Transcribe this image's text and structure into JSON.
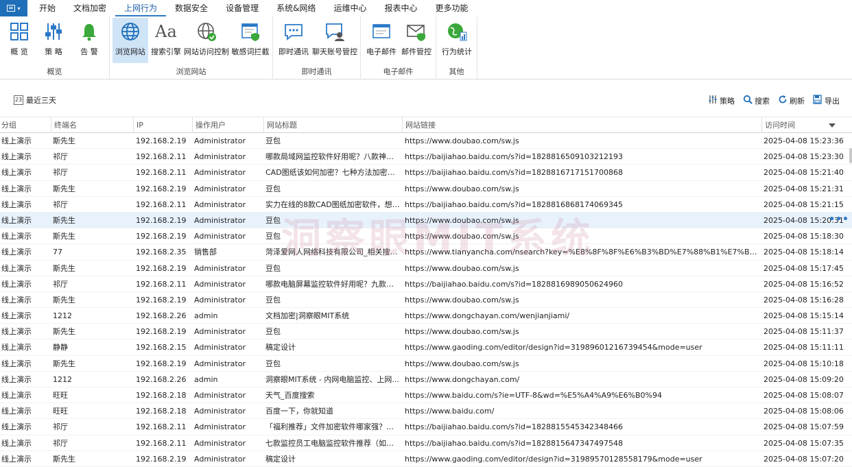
{
  "menubar": {
    "tabs": [
      "开始",
      "文档加密",
      "上网行为",
      "数据安全",
      "设备管理",
      "系统&网络",
      "运维中心",
      "报表中心",
      "更多功能"
    ],
    "active_tab": "上网行为"
  },
  "ribbon": {
    "groups": {
      "overview": {
        "label": "概览",
        "buttons": [
          "概 览",
          "策 略",
          "告 警"
        ]
      },
      "browse": {
        "label": "浏览网站",
        "buttons": [
          "浏览网站",
          "搜索引擎",
          "网站访问控制",
          "敏感词拦截"
        ]
      },
      "im": {
        "label": "即时通讯",
        "buttons": [
          "即时通讯",
          "聊天账号管控"
        ]
      },
      "email": {
        "label": "电子邮件",
        "buttons": [
          "电子邮件",
          "邮件管控"
        ]
      },
      "other": {
        "label": "其他",
        "buttons": [
          "行为统计"
        ]
      }
    }
  },
  "toolbar": {
    "date_range": "最近三天",
    "calendar_num": "23",
    "strategy": "策略",
    "search": "搜索",
    "refresh": "刷新",
    "export": "导出"
  },
  "table": {
    "columns": [
      "分组",
      "终端名",
      "IP",
      "操作用户",
      "网站标题",
      "网站链接",
      "访问时间"
    ],
    "rows": [
      [
        "线上演示",
        "斯先生",
        "192.168.2.19",
        "Administrator",
        "豆包",
        "https://www.doubao.com/sw.js",
        "2025-04-08 15:23:36"
      ],
      [
        "线上演示",
        "祁厅",
        "192.168.2.11",
        "Administrator",
        "哪款局域网监控软件好用呢？八款神级局...",
        "https://baijiahao.baidu.com/s?id=1828816509103212193",
        "2025-04-08 15:23:30"
      ],
      [
        "线上演示",
        "祁厅",
        "192.168.2.11",
        "Administrator",
        "CAD图纸该如何加密？七种方法加密CAD...",
        "https://baijiahao.baidu.com/s?id=1828816717151700868",
        "2025-04-08 15:21:40"
      ],
      [
        "线上演示",
        "斯先生",
        "192.168.2.19",
        "Administrator",
        "豆包",
        "https://www.doubao.com/sw.js",
        "2025-04-08 15:21:31"
      ],
      [
        "线上演示",
        "祁厅",
        "192.168.2.11",
        "Administrator",
        "实力在线的8款CAD图纸加密软件，想要...",
        "https://baijiahao.baidu.com/s?id=1828816868174069345",
        "2025-04-08 15:21:15"
      ],
      [
        "线上演示",
        "斯先生",
        "192.168.2.19",
        "Administrator",
        "豆包",
        "https://www.doubao.com/sw.js",
        "2025-04-08 15:20:31"
      ],
      [
        "线上演示",
        "斯先生",
        "192.168.2.19",
        "Administrator",
        "豆包",
        "https://www.doubao.com/sw.js",
        "2025-04-08 15:18:30"
      ],
      [
        "线上演示",
        "77",
        "192.168.2.35",
        "销售部",
        "菏泽爱网人网络科技有限公司_相关搜索结...",
        "https://www.tianyancha.com/nsearch?key=%E8%8F%8F%E6%B3%BD%E7%88%B1%E7%BD%91%E4%...",
        "2025-04-08 15:18:14"
      ],
      [
        "线上演示",
        "斯先生",
        "192.168.2.19",
        "Administrator",
        "豆包",
        "https://www.doubao.com/sw.js",
        "2025-04-08 15:17:45"
      ],
      [
        "线上演示",
        "祁厅",
        "192.168.2.11",
        "Administrator",
        "哪款电脑屏幕监控软件好用呢？九款高质...",
        "https://baijiahao.baidu.com/s?id=1828816989050624960",
        "2025-04-08 15:16:52"
      ],
      [
        "线上演示",
        "斯先生",
        "192.168.2.19",
        "Administrator",
        "豆包",
        "https://www.doubao.com/sw.js",
        "2025-04-08 15:16:28"
      ],
      [
        "线上演示",
        "1212",
        "192.168.2.26",
        "admin",
        "文档加密|洞察眼MIT系统",
        "https://www.dongchayan.com/wenjianjiami/",
        "2025-04-08 15:15:14"
      ],
      [
        "线上演示",
        "斯先生",
        "192.168.2.19",
        "Administrator",
        "豆包",
        "https://www.doubao.com/sw.js",
        "2025-04-08 15:11:37"
      ],
      [
        "线上演示",
        "静静",
        "192.168.2.15",
        "Administrator",
        "稿定设计",
        "https://www.gaoding.com/editor/design?id=31989601216739454&mode=user",
        "2025-04-08 15:11:11"
      ],
      [
        "线上演示",
        "斯先生",
        "192.168.2.19",
        "Administrator",
        "豆包",
        "https://www.doubao.com/sw.js",
        "2025-04-08 15:10:18"
      ],
      [
        "线上演示",
        "1212",
        "192.168.2.26",
        "admin",
        "洞察眼MIT系统 - 内网电脑监控、上网...",
        "https://www.dongchayan.com/",
        "2025-04-08 15:09:20"
      ],
      [
        "线上演示",
        "旺旺",
        "192.168.2.18",
        "Administrator",
        "天气_百度搜索",
        "https://www.baidu.com/s?ie=UTF-8&wd=%E5%A4%A9%E6%B0%94",
        "2025-04-08 15:08:07"
      ],
      [
        "线上演示",
        "旺旺",
        "192.168.2.18",
        "Administrator",
        "百度一下，你就知道",
        "https://www.baidu.com/",
        "2025-04-08 15:08:06"
      ],
      [
        "线上演示",
        "祁厅",
        "192.168.2.11",
        "Administrator",
        "「福利推荐」文件加密软件哪家强？这八...",
        "https://baijiahao.baidu.com/s?id=1828815545342348466",
        "2025-04-08 15:07:59"
      ],
      [
        "线上演示",
        "祁厅",
        "192.168.2.11",
        "Administrator",
        "七款监控员工电脑监控软件推荐（如何监...",
        "https://baijiahao.baidu.com/s?id=1828815647347497548",
        "2025-04-08 15:07:35"
      ],
      [
        "线上演示",
        "斯先生",
        "192.168.2.19",
        "Administrator",
        "稿定设计",
        "https://www.gaoding.com/editor/design?id=31989570128558179&mode=user",
        "2025-04-08 15:07:20"
      ]
    ],
    "selected_row": 5,
    "row_more": "•••"
  },
  "watermark": "洞察眼MIT系统",
  "colors": {
    "accent": "#2b79c8",
    "selected_row": "#e8f2fc",
    "ribbon_selected": "#cfe4f7"
  }
}
